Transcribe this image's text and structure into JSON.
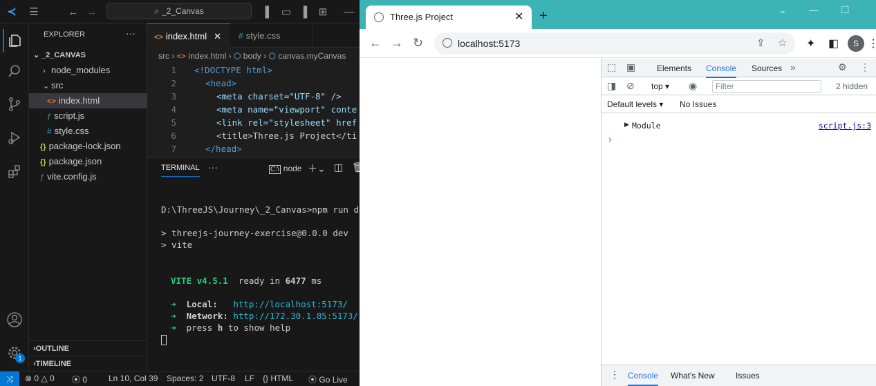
{
  "vscode": {
    "command_center": "_2_Canvas",
    "explorer": {
      "title": "EXPLORER",
      "root": "_2_CANVAS",
      "items": [
        {
          "label": "node_modules"
        },
        {
          "label": "src"
        },
        {
          "label": "index.html"
        },
        {
          "label": "script.js"
        },
        {
          "label": "style.css"
        },
        {
          "label": "package-lock.json"
        },
        {
          "label": "package.json"
        },
        {
          "label": "vite.config.js"
        }
      ],
      "outline": "OUTLINE",
      "timeline": "TIMELINE"
    },
    "tabs": [
      {
        "label": "index.html"
      },
      {
        "label": "style.css"
      }
    ],
    "breadcrumb": [
      "src",
      "index.html",
      "body",
      "canvas.myCanvas"
    ],
    "code_lines": [
      {
        "n": "1",
        "text": "<!DOCTYPE html>"
      },
      {
        "n": "2",
        "text": "<head>"
      },
      {
        "n": "3",
        "text": "<meta charset=\"UTF-8\" />"
      },
      {
        "n": "4",
        "text": "<meta name=\"viewport\" conte"
      },
      {
        "n": "5",
        "text": "<link rel=\"stylesheet\" href"
      },
      {
        "n": "6",
        "text": "<title>Three.js Project</ti"
      },
      {
        "n": "7",
        "text": "</head>"
      }
    ],
    "terminal": {
      "tab": "TERMINAL",
      "shell": "node",
      "lines": {
        "cmd": "D:\\ThreeJS\\Journey\\_2_Canvas>npm run dev",
        "pkg": "> threejs-journey-exercise@0.0.0 dev",
        "vite": "> vite",
        "vite_name": "VITE v4.5.1",
        "ready": "ready in",
        "ms_value": "6477",
        "ms": "ms",
        "local_label": "Local:",
        "local_url": "http://localhost:5173/",
        "network_label": "Network:",
        "network_url": "http://172.30.1.85:5173/",
        "help_pre": "press",
        "help_key": "h",
        "help_post": "to show help"
      }
    },
    "status": {
      "errors": "0",
      "warnings": "0",
      "ports": "0",
      "position": "Ln 10, Col 39",
      "spaces": "Spaces: 2",
      "encoding": "UTF-8",
      "eol": "LF",
      "language": "HTML",
      "golive": "Go Live",
      "badge": "1"
    }
  },
  "browser": {
    "tab_title": "Three.js Project",
    "url": "localhost:5173",
    "profile_initial": "S",
    "devtools": {
      "tabs": [
        "Elements",
        "Console",
        "Sources"
      ],
      "context": "top",
      "filter_placeholder": "Filter",
      "hidden": "2 hidden",
      "levels": "Default levels",
      "issues": "No Issues",
      "message": "Module",
      "source_link": "script.js:3",
      "drawer_tabs": [
        "Console",
        "What's New",
        "Issues"
      ]
    }
  }
}
